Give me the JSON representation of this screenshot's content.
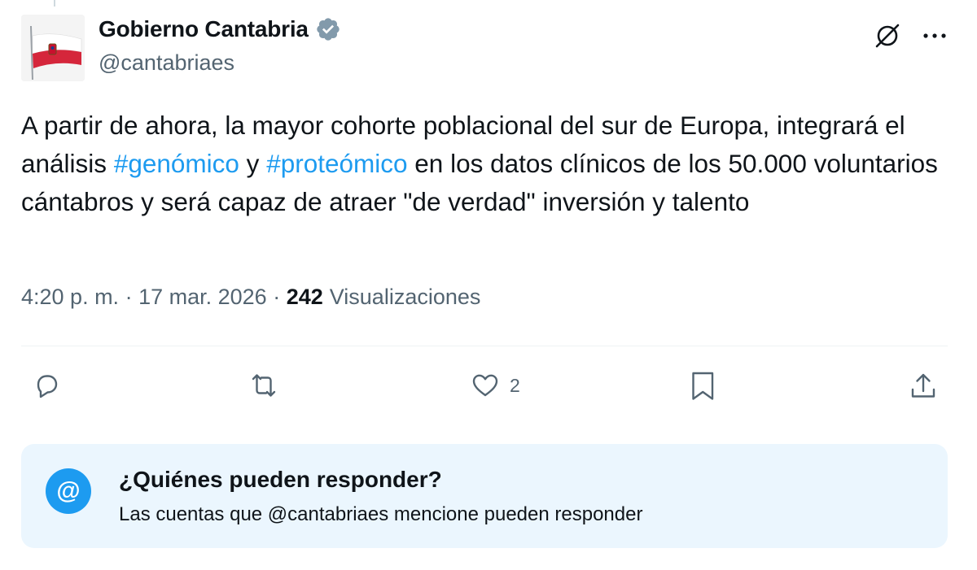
{
  "author": {
    "display_name": "Gobierno Cantabria",
    "handle": "@cantabriaes",
    "verified": true
  },
  "tweet": {
    "text_part1": "A partir de ahora, la mayor cohorte poblacional del sur de Europa, integrará el análisis ",
    "hashtag1": "#genómico",
    "text_part2": " y ",
    "hashtag2": "#proteómico",
    "text_part3": " en los datos clínicos de los 50.000 voluntarios cántabros y será capaz de atraer \"de verdad\" inversión y talento"
  },
  "meta": {
    "time": "4:20 p. m.",
    "separator": " · ",
    "date": "17 mar. 2026",
    "views_count": "242",
    "views_label": "Visualizaciones"
  },
  "actions": {
    "reply_icon": "reply-icon",
    "retweet_icon": "retweet-icon",
    "like_icon": "heart-icon",
    "like_count": "2",
    "bookmark_icon": "bookmark-icon",
    "share_icon": "share-icon"
  },
  "reply_restriction": {
    "icon_glyph": "@",
    "title": "¿Quiénes pueden responder?",
    "description": "Las cuentas que @cantabriaes mencione pueden responder"
  },
  "colors": {
    "accent": "#1d9bf0",
    "secondary_text": "#536471",
    "info_box_bg": "#ebf6fe"
  }
}
